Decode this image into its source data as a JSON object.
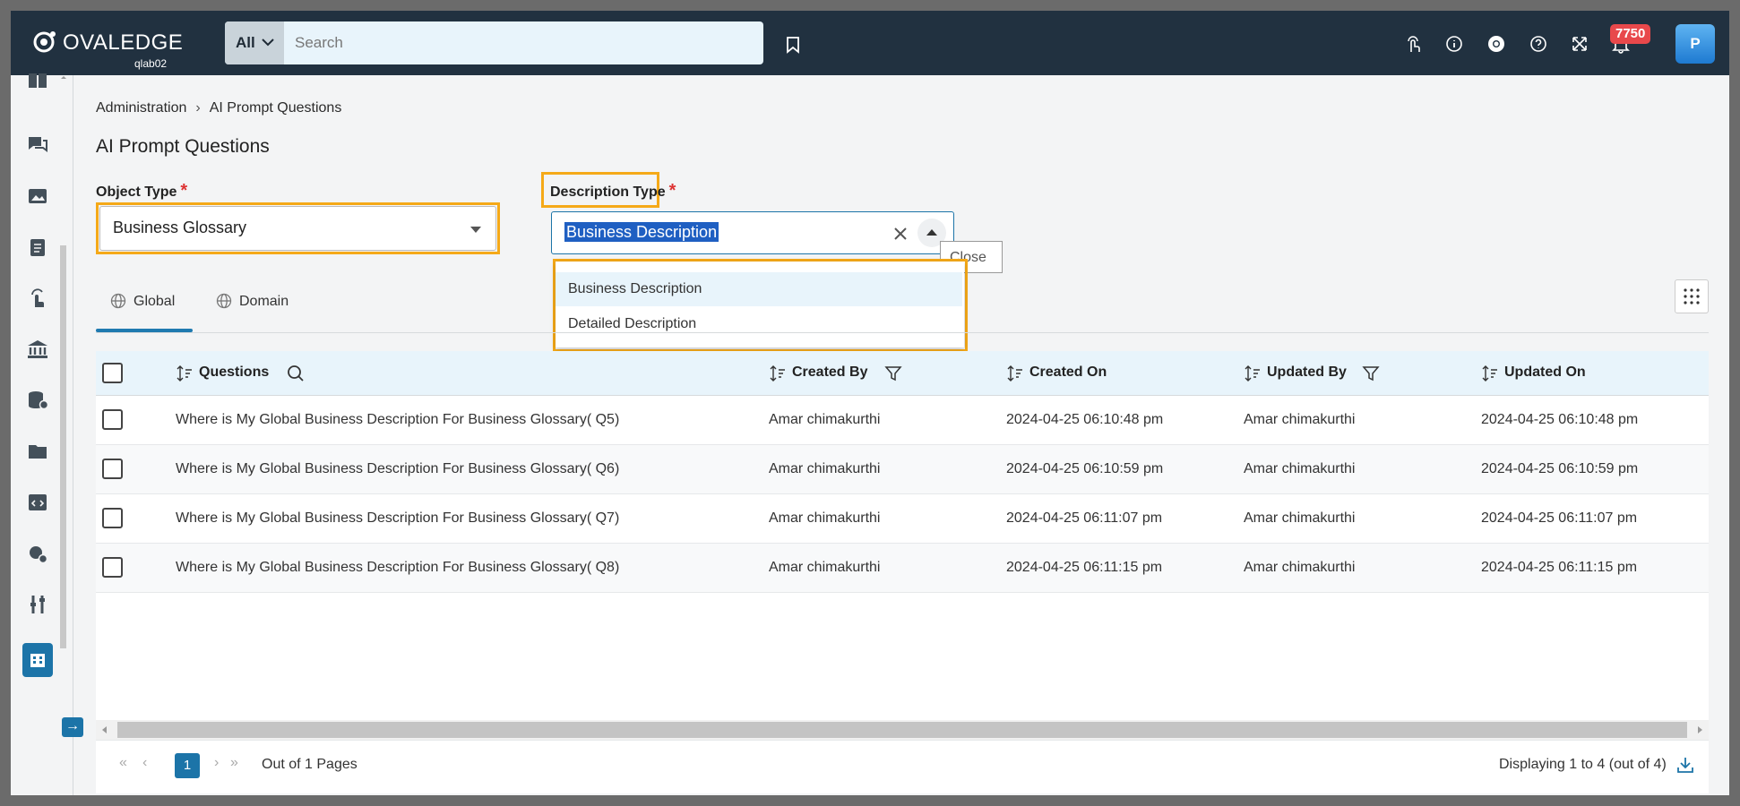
{
  "app": {
    "name": "OVALEDGE",
    "instance": "qlab02"
  },
  "search": {
    "scope": "All",
    "placeholder": "Search"
  },
  "header": {
    "notification_count": "7750",
    "avatar_initial": "P"
  },
  "breadcrumb": {
    "parent": "Administration",
    "current": "AI Prompt Questions"
  },
  "page_title": "AI Prompt Questions",
  "object_type": {
    "label": "Object Type",
    "required": "*",
    "value": "Business Glossary"
  },
  "description_type": {
    "label": "Description Type",
    "required": "*",
    "value": "Business Description",
    "options": [
      "Business Description",
      "Detailed Description"
    ],
    "tooltip": "Close"
  },
  "tabs": [
    {
      "label": "Global"
    },
    {
      "label": "Domain"
    }
  ],
  "table": {
    "columns": [
      "Questions",
      "Created By",
      "Created On",
      "Updated By",
      "Updated On"
    ],
    "rows": [
      {
        "question": "Where is My Global Business Description For Business Glossary( Q5)",
        "created_by": "Amar chimakurthi",
        "created_on": "2024-04-25 06:10:48 pm",
        "updated_by": "Amar chimakurthi",
        "updated_on": "2024-04-25 06:10:48 pm"
      },
      {
        "question": "Where is My Global Business Description For Business Glossary( Q6)",
        "created_by": "Amar chimakurthi",
        "created_on": "2024-04-25 06:10:59 pm",
        "updated_by": "Amar chimakurthi",
        "updated_on": "2024-04-25 06:10:59 pm"
      },
      {
        "question": "Where is My Global Business Description For Business Glossary( Q7)",
        "created_by": "Amar chimakurthi",
        "created_on": "2024-04-25 06:11:07 pm",
        "updated_by": "Amar chimakurthi",
        "updated_on": "2024-04-25 06:11:07 pm"
      },
      {
        "question": "Where is My Global Business Description For Business Glossary( Q8)",
        "created_by": "Amar chimakurthi",
        "created_on": "2024-04-25 06:11:15 pm",
        "updated_by": "Amar chimakurthi",
        "updated_on": "2024-04-25 06:11:15 pm"
      }
    ]
  },
  "pagination": {
    "page": "1",
    "pages_text": "Out of 1 Pages",
    "display_text": "Displaying 1 to 4 (out of 4)"
  },
  "colors": {
    "topbar": "#213140",
    "accent": "#1c74a8",
    "highlight": "#f5a918",
    "badge": "#e8484b"
  }
}
